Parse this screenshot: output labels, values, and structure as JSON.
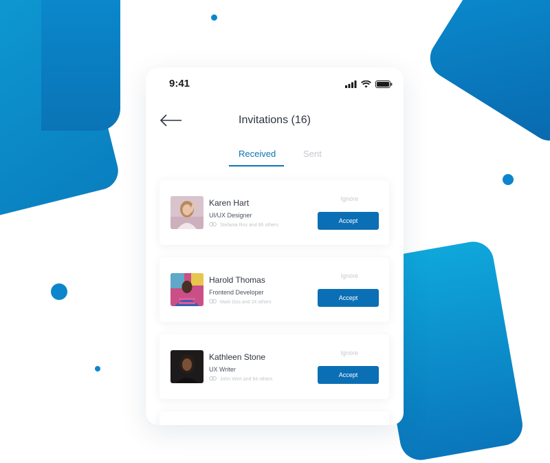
{
  "status_bar": {
    "time": "9:41"
  },
  "header": {
    "title": "Invitations (16)"
  },
  "tabs": [
    {
      "label": "Received",
      "active": true
    },
    {
      "label": "Sent",
      "active": false
    }
  ],
  "invitations": [
    {
      "name": "Karen Hart",
      "role": "UI/UX Designer",
      "mutual": "Stefania Rox and 86 others",
      "ignore_label": "Ignore",
      "accept_label": "Accept"
    },
    {
      "name": "Harold Thomas",
      "role": "Frontend Developer",
      "mutual": "Mark Dos and 24 others",
      "ignore_label": "Ignore",
      "accept_label": "Accept"
    },
    {
      "name": "Kathleen Stone",
      "role": "UX Writer",
      "mutual": "John Wert and 94 others",
      "ignore_label": "Ignore",
      "accept_label": "Accept"
    }
  ],
  "colors": {
    "accent": "#0b6fb5",
    "muted": "#c4c8cf",
    "text": "#2e3440",
    "background_shapes": "#0a86cc"
  },
  "icons": [
    "back-arrow-icon",
    "signal-icon",
    "wifi-icon",
    "battery-icon",
    "link-icon"
  ]
}
